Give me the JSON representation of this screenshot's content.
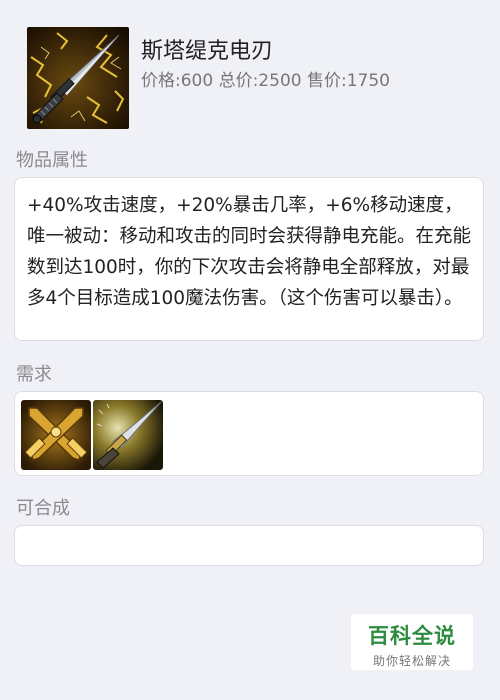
{
  "item": {
    "name": "斯塔缇克电刃",
    "price": "价格:600 总价:2500 售价:1750",
    "icon": "electric-dagger-icon"
  },
  "sections": {
    "attributes_title": "物品属性",
    "requirements_title": "需求",
    "combinable_title": "可合成"
  },
  "attributes_text": "+40%攻击速度，+20%暴击几率，+6%移动速度，唯一被动：移动和攻击的同时会获得静电充能。在充能数到达100时，你的下次攻击会将静电全部释放，对最多4个目标造成100魔法伤害。（这个伤害可以暴击）。",
  "requirements": [
    {
      "icon": "zeal-crossed-swords-icon"
    },
    {
      "icon": "dagger-icon"
    }
  ],
  "watermark": {
    "main": "百科全说",
    "sub": "助你轻松解决"
  }
}
